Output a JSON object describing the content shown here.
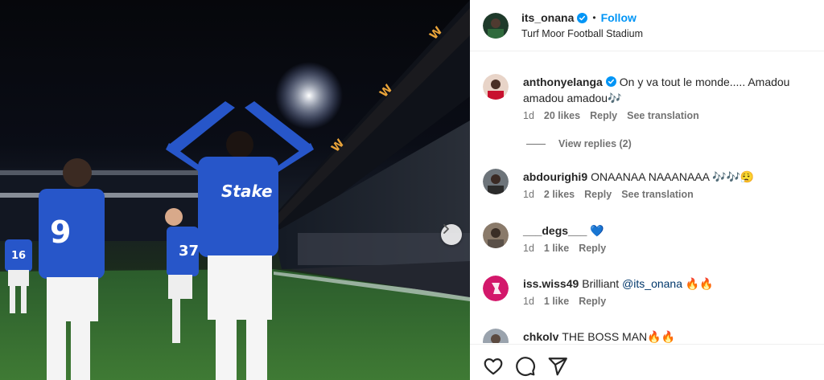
{
  "colors": {
    "link": "#0095f6",
    "verified": "#0095f6",
    "everton_blue": "#2756c9"
  },
  "photo": {
    "next_icon": "chevron-right-icon"
  },
  "post": {
    "username": "its_onana",
    "follow_label": "Follow",
    "dot": "•",
    "location": "Turf Moor Football Stadium"
  },
  "comments": [
    {
      "username": "anthonyelanga",
      "verified": true,
      "text": "On y va tout le monde..... Amadou amadou amadou🎶",
      "time": "1d",
      "likes": "20 likes",
      "reply": "Reply",
      "translate": "See translation",
      "view_replies": "View replies (2)"
    },
    {
      "username": "abdourighi9",
      "text": "ONAANAA NAAANAAA 🎶🎶😮‍💨",
      "time": "1d",
      "likes": "2 likes",
      "reply": "Reply",
      "translate": "See translation"
    },
    {
      "username": "___degs___",
      "text": "💙",
      "time": "1d",
      "likes": "1 like",
      "reply": "Reply"
    },
    {
      "username": "iss.wiss49",
      "text_before": "Brilliant ",
      "mention": "@its_onana",
      "text_after": " 🔥🔥",
      "time": "1d",
      "likes": "1 like",
      "reply": "Reply"
    },
    {
      "username": "chkolv",
      "text": "THE BOSS MAN🔥🔥"
    }
  ],
  "actions": [
    "heart-icon",
    "comment-icon",
    "share-icon"
  ]
}
